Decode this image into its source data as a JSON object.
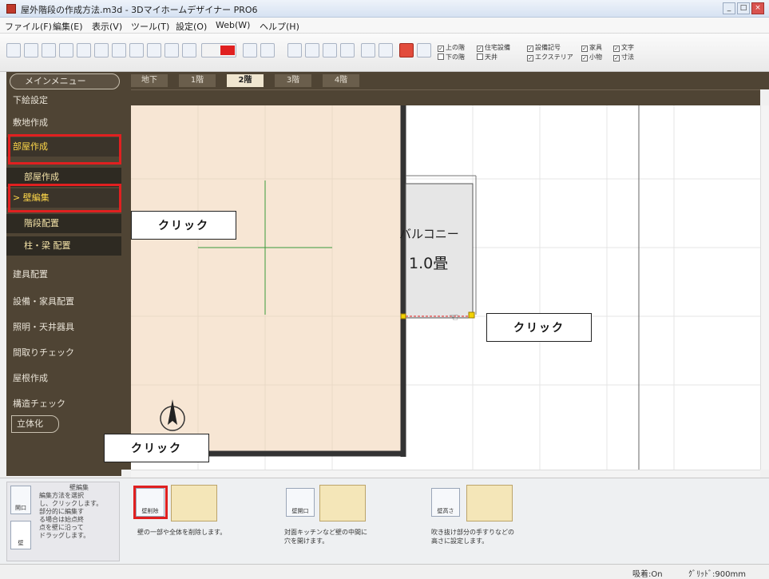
{
  "window": {
    "title": "屋外階段の作成方法.m3d - 3Dマイホームデザイナー PRO6",
    "minimize_glyph": "_",
    "maximize_glyph": "□",
    "close_glyph": "×"
  },
  "menu": [
    "ファイル(F)",
    "編集(E)",
    "表示(V)",
    "ツール(T)",
    "設定(O)",
    "Web(W)",
    "ヘルプ(H)"
  ],
  "toolbar": {
    "display_checks": [
      {
        "label": "上の階",
        "checked": true
      },
      {
        "label": "住宅設備",
        "checked": true
      },
      {
        "label": "設備記号",
        "checked": true
      },
      {
        "label": "家具",
        "checked": true
      },
      {
        "label": "文字",
        "checked": true
      },
      {
        "label": "下の階",
        "checked": false
      },
      {
        "label": "天井",
        "checked": false
      },
      {
        "label": "エクステリア",
        "checked": true
      },
      {
        "label": "小物",
        "checked": true
      },
      {
        "label": "寸法",
        "checked": true
      }
    ]
  },
  "sidebar": {
    "main_menu": "メインメニュー",
    "items": [
      "下絵設定",
      "敷地作成",
      "部屋作成",
      "部屋作成",
      "壁編集",
      "階段配置",
      "柱・梁 配置",
      "建具配置",
      "設備・家具配置",
      "照明・天井器具",
      "間取りチェック",
      "屋根作成",
      "構造チェック",
      "立体化"
    ]
  },
  "floor_tabs": [
    "地下",
    "1階",
    "2階",
    "3階",
    "4階"
  ],
  "active_floor": "2階",
  "canvas": {
    "room_label_name": "バルコニー",
    "room_label_size": "1.0畳"
  },
  "callouts": [
    "クリック",
    "クリック",
    "クリック"
  ],
  "bottom_panel": {
    "help_title": "壁編集",
    "help_text": [
      "編集方法を選択",
      "し、クリックします。",
      "部分的に編集す",
      "る場合は始点終",
      "点を壁に沿って",
      "ドラッグします。"
    ],
    "modes": [
      "開口",
      "壁"
    ],
    "tools": [
      {
        "label": "壁削除",
        "desc": [
          "壁の一部や全体を削除します。"
        ]
      },
      {
        "label": "壁開口",
        "desc": [
          "対面キッチンなど壁の中間に",
          "穴を開けます。"
        ]
      },
      {
        "label": "壁高さ",
        "desc": [
          "吹き抜け部分の手すりなどの",
          "高さに設定します。"
        ]
      }
    ]
  },
  "status": {
    "snap": "吸着:On",
    "grid": "ｸﾞﾘｯﾄﾞ:900mm"
  },
  "colors": {
    "sidebar_bg": "#4f4434",
    "highlight_red": "#e02020",
    "room_fill": "#f7e6d4",
    "wall": "#333333"
  }
}
